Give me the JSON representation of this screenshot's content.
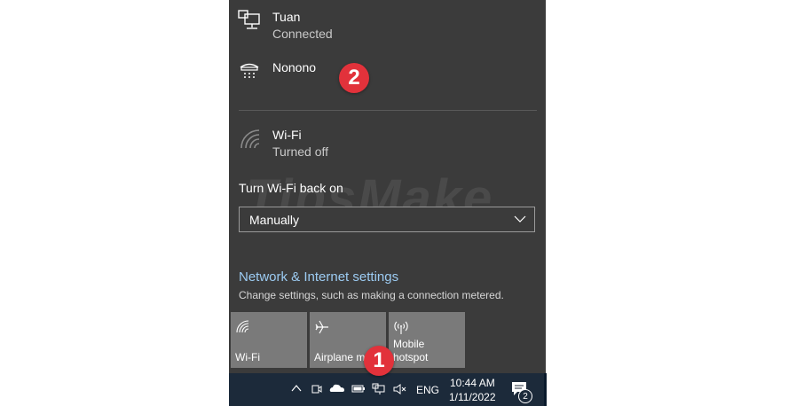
{
  "networks": [
    {
      "name": "Tuan",
      "status": "Connected",
      "icon": "ethernet-icon"
    },
    {
      "name": "Nonono",
      "status": "",
      "icon": "dialup-icon"
    }
  ],
  "wifi": {
    "name": "Wi-Fi",
    "status": "Turned off",
    "icon": "wifi-off-icon"
  },
  "turn_back": {
    "label": "Turn Wi-Fi back on",
    "selected": "Manually"
  },
  "watermark": {
    "text": "TipsMake",
    "suffix": ".com"
  },
  "settings": {
    "link": "Network & Internet settings",
    "description": "Change settings, such as making a connection metered."
  },
  "tiles": [
    {
      "label": "Wi-Fi",
      "icon": "wifi-icon"
    },
    {
      "label": "Airplane mode",
      "icon": "airplane-icon"
    },
    {
      "label": "Mobile hotspot",
      "label_lines": [
        "Mobile",
        "hotspot"
      ],
      "icon": "hotspot-icon"
    }
  ],
  "taskbar": {
    "language": "ENG",
    "time": "10:44 AM",
    "date": "1/11/2022",
    "notification_count": "2"
  },
  "annotations": {
    "badge1": "1",
    "badge2": "2"
  },
  "colors": {
    "flyout_bg": "#3b3b3b",
    "tile_bg": "#7a7a7a",
    "taskbar_bg": "#1c2a3a",
    "link": "#9ccbf2",
    "badge": "#e2323b"
  }
}
